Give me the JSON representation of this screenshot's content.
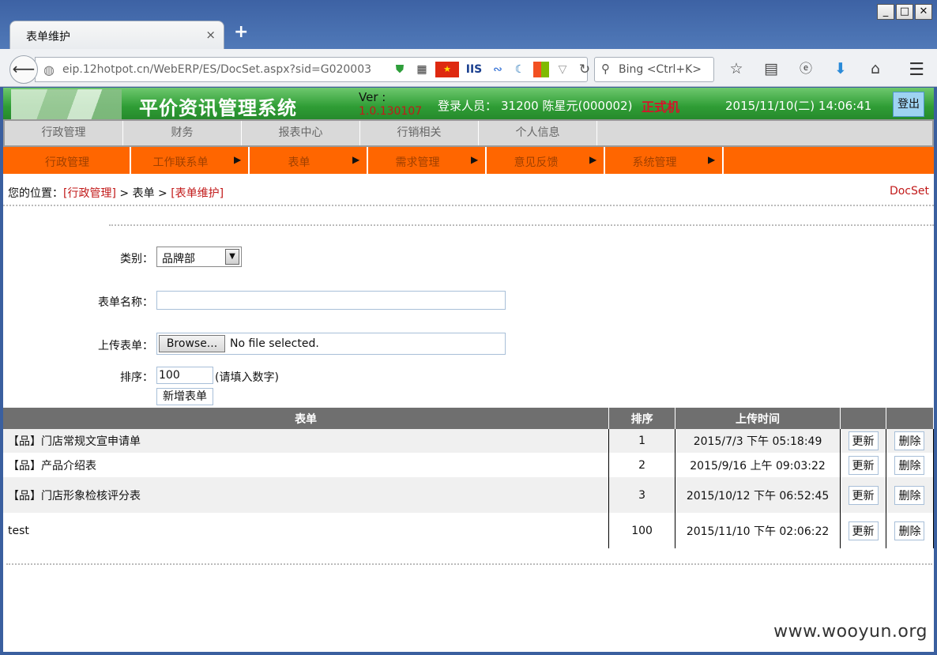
{
  "browser": {
    "tab_title": "表单维护",
    "tab_close": "×",
    "new_tab": "+",
    "window_buttons": [
      "_",
      "□",
      "✕"
    ],
    "url": "eip.12hotpot.cn/WebERP/ES/DocSet.aspx?sid=G020003",
    "search_placeholder": "Bing <Ctrl+K>"
  },
  "header": {
    "system_title": "平价资讯管理系统",
    "version_label": "Ver :",
    "version_number": "1.0.130107",
    "login_label": "登录人员：",
    "login_user": "31200 陈星元(000002)",
    "login_mode": "正式机",
    "datetime": "2015/11/10(二) 14:06:41",
    "logout_label": "登出"
  },
  "menu_primary": [
    "行政管理",
    "财务",
    "报表中心",
    "行销相关",
    "个人信息"
  ],
  "menu_secondary": [
    {
      "label": "行政管理",
      "arrow": ""
    },
    {
      "label": "工作联系单",
      "arrow": "▶"
    },
    {
      "label": "表单",
      "arrow": "▶"
    },
    {
      "label": "需求管理",
      "arrow": "▶"
    },
    {
      "label": "意见反馈",
      "arrow": "▶"
    },
    {
      "label": "系统管理",
      "arrow": "▶"
    }
  ],
  "breadcrumb": {
    "prefix": "您的位置：",
    "level1": "[行政管理]",
    "sep1": " > ",
    "level2": "表单",
    "sep2": " > ",
    "level3": "[表单维护]",
    "page_code": "DocSet"
  },
  "form": {
    "category_label": "类别：",
    "category_value": "品牌部",
    "name_label": "表单名称：",
    "name_value": "",
    "upload_label": "上传表单：",
    "browse_label": "Browse...",
    "file_status": "No file selected.",
    "order_label": "排序：",
    "order_value": "100",
    "order_hint": "(请填入数字)",
    "add_button": "新增表单"
  },
  "table": {
    "headers": [
      "表单",
      "排序",
      "上传时间",
      "",
      ""
    ],
    "rows": [
      {
        "name": "【品】门店常规文宣申请单",
        "order": "1",
        "time": "2015/7/3 下午 05:18:49",
        "update": "更新",
        "delete": "删除"
      },
      {
        "name": "【品】产品介绍表",
        "order": "2",
        "time": "2015/9/16 上午 09:03:22",
        "update": "更新",
        "delete": "删除"
      },
      {
        "name": "【品】门店形象检核评分表",
        "order": "3",
        "time": "2015/10/12 下午 06:52:45",
        "update": "更新",
        "delete": "删除"
      },
      {
        "name": "test",
        "order": "100",
        "time": "2015/11/10 下午 02:06:22",
        "update": "更新",
        "delete": "删除"
      }
    ]
  },
  "watermark": "www.wooyun.org",
  "colors": {
    "header_green": "#2f9d35",
    "menu_orange": "#ff6600",
    "link_red": "#c21a1a",
    "table_header": "#6f6f6f"
  }
}
